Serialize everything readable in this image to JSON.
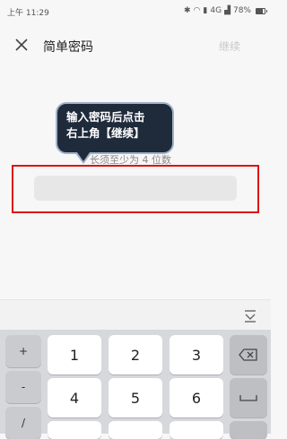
{
  "status": {
    "time": "上午 11:29",
    "network": "4G",
    "battery": "78%",
    "battery_level": 0.78
  },
  "header": {
    "title": "简单密码",
    "continue_label": "继续",
    "close_icon": "close-icon"
  },
  "callout": {
    "line1": "输入密码后点击",
    "line2": "右上角【继续】"
  },
  "form": {
    "hint": "长须至少为 4 位数",
    "password_value": "",
    "password_placeholder": ""
  },
  "keyboard": {
    "side_keys": [
      "+",
      "-",
      "/"
    ],
    "digits_row1": [
      "1",
      "2",
      "3"
    ],
    "digits_row2": [
      "4",
      "5",
      "6"
    ],
    "backspace_icon": "backspace-icon",
    "space_icon": "space-icon",
    "collapse_icon": "keyboard-collapse-icon"
  },
  "colors": {
    "highlight": "#e01010",
    "callout_bg": "#1f2a3b"
  }
}
